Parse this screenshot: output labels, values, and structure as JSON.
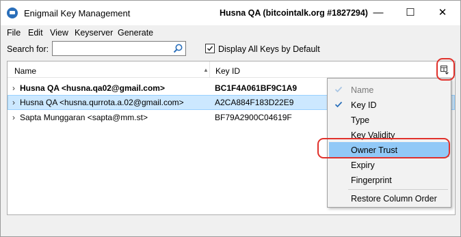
{
  "window": {
    "title": "Enigmail Key Management",
    "user": "Husna QA (bitcointalk.org #1827294)",
    "controls": {
      "minimize": "—",
      "maximize": "☐",
      "close": "✕"
    }
  },
  "menubar": {
    "items": [
      {
        "label": "File"
      },
      {
        "label": "Edit"
      },
      {
        "label": "View"
      },
      {
        "label": "Keyserver"
      },
      {
        "label": "Generate"
      }
    ]
  },
  "search": {
    "label": "Search for:",
    "value": "",
    "placeholder": "",
    "icon": "search-icon"
  },
  "display_all": {
    "label": "Display All Keys by Default",
    "checked": true
  },
  "table": {
    "columns": [
      {
        "label": "Name",
        "sort": "ascending"
      },
      {
        "label": "Key ID"
      }
    ],
    "rows": [
      {
        "name": "Husna QA <husna.qa02@gmail.com>",
        "key_id": "BC1F4A061BF9C1A9",
        "bold": true,
        "selected": false
      },
      {
        "name": "Husna QA <husna.qurrota.a.02@gmail.com>",
        "key_id": "A2CA884F183D22E9",
        "bold": false,
        "selected": true
      },
      {
        "name": "Sapta Munggaran <sapta@mm.st>",
        "key_id": "BF79A2900C04619F",
        "bold": false,
        "selected": false
      }
    ]
  },
  "column_menu": {
    "items": [
      {
        "label": "Name",
        "checked": true,
        "disabled": true
      },
      {
        "label": "Key ID",
        "checked": true,
        "disabled": false
      },
      {
        "label": "Type",
        "checked": false,
        "disabled": false
      },
      {
        "label": "Key Validity",
        "checked": false,
        "disabled": false
      },
      {
        "label": "Owner Trust",
        "checked": false,
        "disabled": false,
        "highlighted": true
      },
      {
        "label": "Expiry",
        "checked": false,
        "disabled": false
      },
      {
        "label": "Fingerprint",
        "checked": false,
        "disabled": false
      },
      {
        "label": "Restore Column Order",
        "checked": false,
        "disabled": false
      }
    ]
  },
  "colors": {
    "selection": "#cce8ff",
    "menu_highlight": "#91c9f7",
    "annotation": "#e0302a",
    "check": "#2a6fba"
  }
}
